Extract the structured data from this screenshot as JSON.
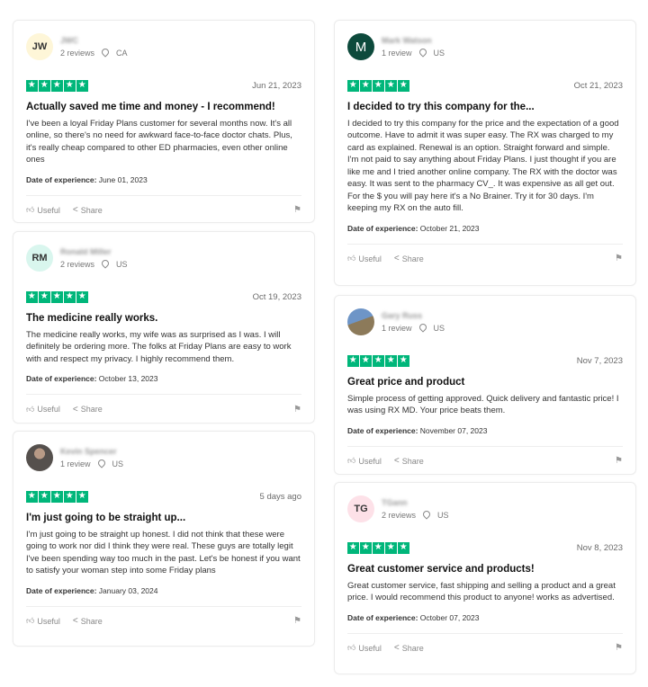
{
  "labels": {
    "useful": "Useful",
    "share": "Share",
    "date_of_experience": "Date of experience:",
    "star_glyph": "★"
  },
  "left_reviews": [
    {
      "initials": "JW",
      "name": "JWC",
      "review_count": "2 reviews",
      "country": "CA",
      "date": "Jun 21, 2023",
      "title": "Actually saved me time and money - I recommend!",
      "body": "I've been a loyal Friday Plans customer for several months now. It's all online, so there's no need for awkward face-to-face doctor chats. Plus, it's really cheap compared to other ED pharmacies, even other online ones",
      "experience_date": "June 01, 2023"
    },
    {
      "initials": "RM",
      "name": "Ronald Miller",
      "review_count": "2 reviews",
      "country": "US",
      "date": "Oct 19, 2023",
      "title": "The medicine really works.",
      "body": "The medicine really works, my wife was as surprised as I was. I will definitely be ordering more. The folks at Friday Plans are easy to work with and respect my privacy. I highly recommend them.",
      "experience_date": "October 13, 2023"
    },
    {
      "initials": "",
      "name": "Kevin Spencer",
      "review_count": "1 review",
      "country": "US",
      "date": "5 days ago",
      "title": "I'm just going to be straight up...",
      "body": "I'm just going to be straight up honest. I did not think that these were going to work nor did I think they were real. These guys are totally legit I've been spending way too much in the past. Let's be honest if you want to satisfy your woman step into some Friday plans",
      "experience_date": "January 03, 2024"
    }
  ],
  "right_reviews": [
    {
      "initials": "M",
      "name": "Mark Watson",
      "review_count": "1 review",
      "country": "US",
      "date": "Oct 21, 2023",
      "title": "I decided to try this company for the...",
      "body": "I decided to try this company for the price and the expectation of a good outcome. Have to admit it was super easy. The RX was charged to my card as explained. Renewal is an option. Straight forward and simple. I'm not paid to say anything about Friday Plans. I just thought if you are like me and I tried another online company. The RX with the doctor was easy. It was sent to the pharmacy CV_. It was expensive as all get out. For the $ you will pay here it's a No Brainer. Try it for 30 days. I'm keeping my RX on the auto fill.",
      "experience_date": "October 21, 2023"
    },
    {
      "initials": "",
      "name": "Gary Russ",
      "review_count": "1 review",
      "country": "US",
      "date": "Nov 7, 2023",
      "title": "Great price and product",
      "body": "Simple process of getting approved. Quick delivery and fantastic price! I was using RX MD. Your price beats them.",
      "experience_date": "November 07, 2023"
    },
    {
      "initials": "TG",
      "name": "TGann",
      "review_count": "2 reviews",
      "country": "US",
      "date": "Nov 8, 2023",
      "title": "Great customer service and products!",
      "body": "Great customer service, fast shipping and selling a product and a great price. I would recommend this product to anyone! works as advertised.",
      "experience_date": "October 07, 2023"
    }
  ]
}
